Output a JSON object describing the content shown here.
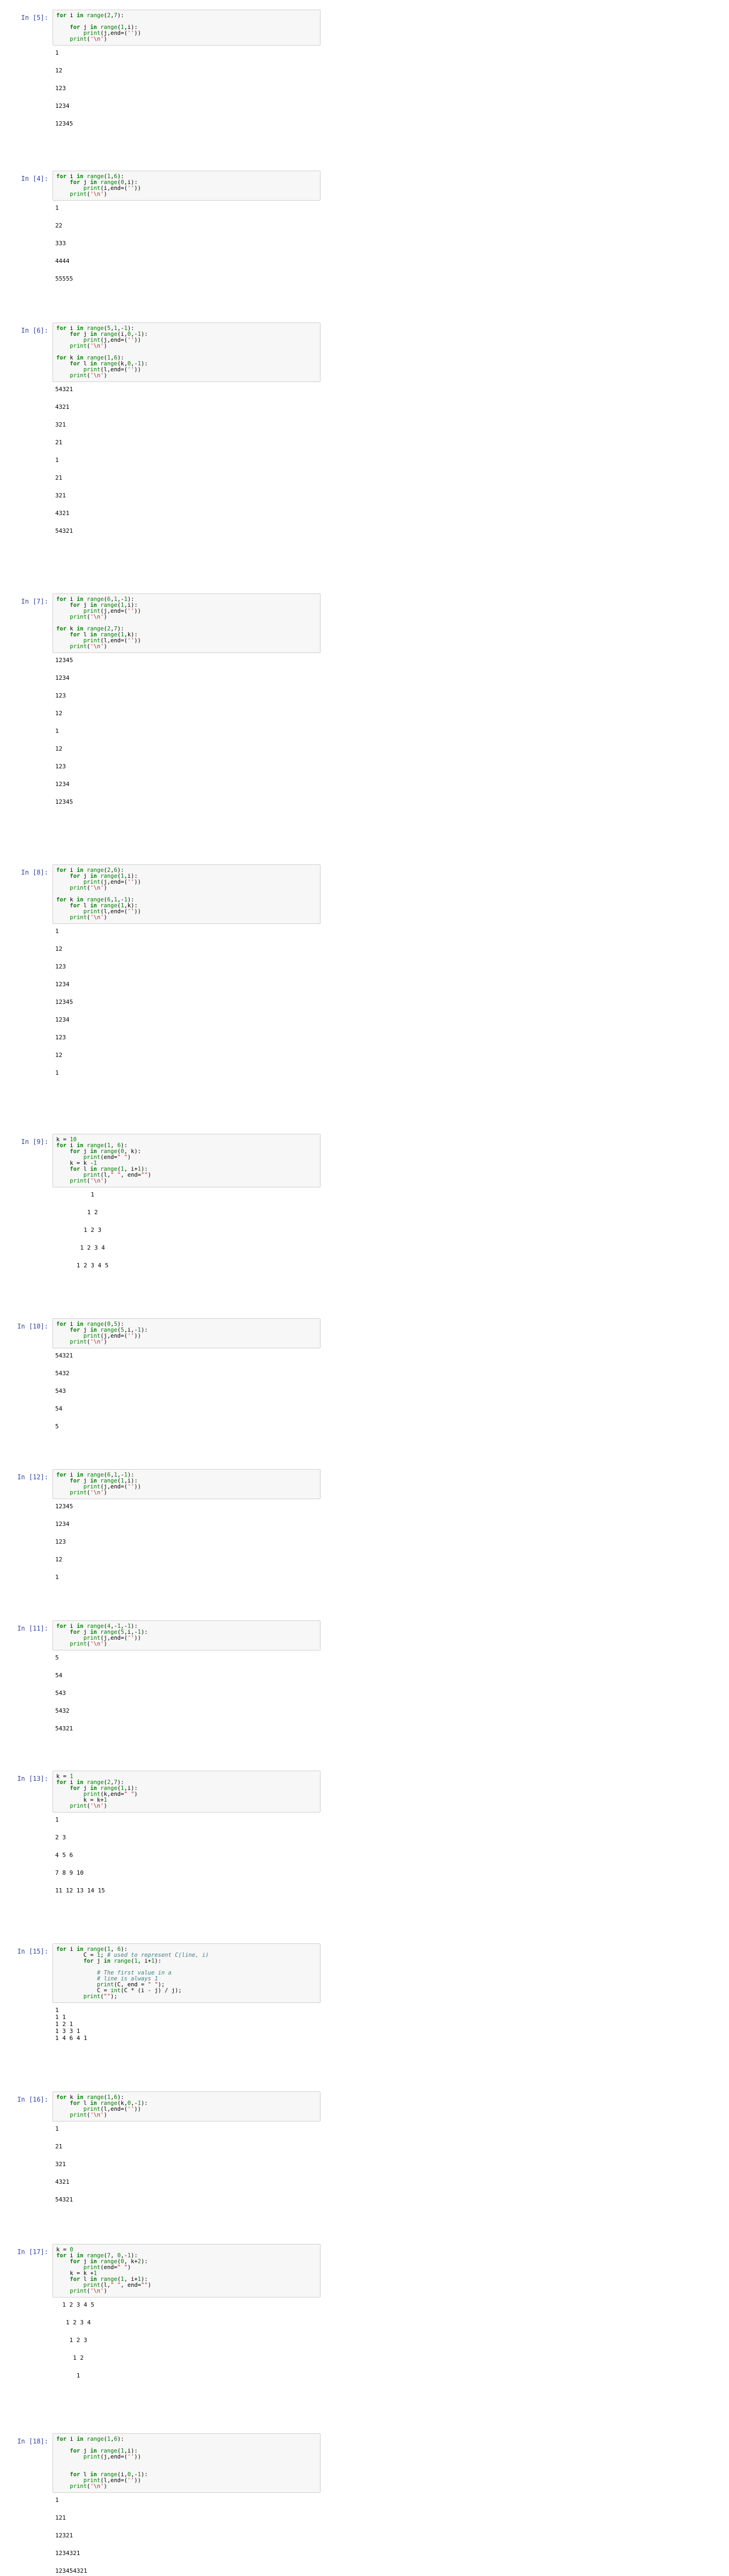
{
  "notebook": {
    "cells": [
      {
        "prompt": "In [5]:",
        "code": [
          "for i in range(2,7):",
          "",
          "    for j in range(1,i):",
          "        print(j,end=(''))",
          "    print('\\n')"
        ],
        "output": [
          "1",
          "",
          "12",
          "",
          "123",
          "",
          "1234",
          "",
          "12345",
          ""
        ]
      },
      {
        "prompt": "In [4]:",
        "code": [
          "for i in range(1,6):",
          "    for j in range(0,i):",
          "        print(i,end=(''))",
          "    print('\\n')"
        ],
        "output": [
          "1",
          "",
          "22",
          "",
          "333",
          "",
          "4444",
          "",
          "55555",
          ""
        ]
      },
      {
        "prompt": "In [6]:",
        "code": [
          "for i in range(5,1,-1):",
          "    for j in range(i,0,-1):",
          "        print(j,end=(''))",
          "    print('\\n')",
          "",
          "for k in range(1,6):",
          "    for l in range(k,0,-1):",
          "        print(l,end=(''))",
          "    print('\\n')"
        ],
        "output": [
          "54321",
          "",
          "4321",
          "",
          "321",
          "",
          "21",
          "",
          "1",
          "",
          "21",
          "",
          "321",
          "",
          "4321",
          "",
          "54321",
          ""
        ]
      },
      {
        "prompt": "In [7]:",
        "code": [
          "for i in range(6,1,-1):",
          "    for j in range(1,i):",
          "        print(j,end=(''))",
          "    print('\\n')",
          "",
          "for k in range(2,7):",
          "    for l in range(1,k):",
          "        print(l,end=(''))",
          "    print('\\n')"
        ],
        "output": [
          "12345",
          "",
          "1234",
          "",
          "123",
          "",
          "12",
          "",
          "1",
          "",
          "12",
          "",
          "123",
          "",
          "1234",
          "",
          "12345",
          ""
        ]
      },
      {
        "prompt": "In [8]:",
        "code": [
          "for i in range(2,6):",
          "    for j in range(1,i):",
          "        print(j,end=(''))",
          "    print('\\n')",
          "",
          "for k in range(6,1,-1):",
          "    for l in range(1,k):",
          "        print(l,end=(''))",
          "    print('\\n')"
        ],
        "output": [
          "1",
          "",
          "12",
          "",
          "123",
          "",
          "1234",
          "",
          "12345",
          "",
          "1234",
          "",
          "123",
          "",
          "12",
          "",
          "1",
          ""
        ]
      },
      {
        "prompt": "In [9]:",
        "code": [
          "k = 10",
          "for i in range(1, 6):",
          "    for j in range(0, k):",
          "        print(end=\" \")",
          "    k = k -1",
          "    for l in range(1, i+1):",
          "        print(l,\" \", end=\"\")",
          "    print('\\n')"
        ],
        "output": [
          "          1",
          "",
          "         1 2",
          "",
          "        1 2 3",
          "",
          "       1 2 3 4",
          "",
          "      1 2 3 4 5",
          ""
        ]
      },
      {
        "prompt": "In [10]:",
        "code": [
          "for i in range(0,5):",
          "    for j in range(5,i,-1):",
          "        print(j,end=(''))",
          "    print('\\n')"
        ],
        "output": [
          "54321",
          "",
          "5432",
          "",
          "543",
          "",
          "54",
          "",
          "5",
          ""
        ]
      },
      {
        "prompt": "In [12]:",
        "code": [
          "for i in range(6,1,-1):",
          "    for j in range(1,i):",
          "        print(j,end=(''))",
          "    print('\\n')"
        ],
        "output": [
          "12345",
          "",
          "1234",
          "",
          "123",
          "",
          "12",
          "",
          "1",
          ""
        ]
      },
      {
        "prompt": "In [11]:",
        "code": [
          "for i in range(4,-1,-1):",
          "    for j in range(5,i,-1):",
          "        print(j,end=(''))",
          "    print('\\n')"
        ],
        "output": [
          "5",
          "",
          "54",
          "",
          "543",
          "",
          "5432",
          "",
          "54321",
          ""
        ]
      },
      {
        "prompt": "In [13]:",
        "code": [
          "k = 1",
          "for i in range(2,7):",
          "    for j in range(1,i):",
          "        print(k,end=\" \")",
          "        k = k+1",
          "    print('\\n')"
        ],
        "output": [
          "1",
          "",
          "2 3",
          "",
          "4 5 6",
          "",
          "7 8 9 10",
          "",
          "11 12 13 14 15",
          ""
        ]
      },
      {
        "prompt": "In [15]:",
        "code": [
          "for i in range(1, 6):",
          "        C = 1; # used to represent C(line, i)",
          "        for j in range(1, i+1):",
          "",
          "            # The first value in a",
          "            # line is always 1",
          "            print(C, end = \" \");",
          "            C = int(C * (i - j) / j);",
          "        print(\"\");"
        ],
        "output_compact": true,
        "output": [
          "1",
          "1 1",
          "1 2 1",
          "1 3 3 1",
          "1 4 6 4 1"
        ]
      },
      {
        "prompt": "In [16]:",
        "code": [
          "for k in range(1,6):",
          "    for l in range(k,0,-1):",
          "        print(l,end=(''))",
          "    print('\\n')"
        ],
        "output": [
          "1",
          "",
          "21",
          "",
          "321",
          "",
          "4321",
          "",
          "54321",
          ""
        ]
      },
      {
        "prompt": "In [17]:",
        "code": [
          "k = 0",
          "for i in range(7, 0,-1):",
          "    for j in range(0, k+2):",
          "        print(end=\" \")",
          "    k = k +1",
          "    for l in range(1, i+1):",
          "        print(l,\" \", end=\"\")",
          "    print('\\n')"
        ],
        "output": [
          "  1 2 3 4 5",
          "",
          "   1 2 3 4",
          "",
          "    1 2 3",
          "",
          "     1 2",
          "",
          "      1",
          ""
        ]
      },
      {
        "prompt": "In [18]:",
        "code": [
          "for i in range(1,6):",
          "",
          "    for j in range(1,i):",
          "        print(j,end=(''))",
          "",
          "",
          "    for l in range(i,0,-1):",
          "        print(l,end=(''))",
          "    print('\\n')"
        ],
        "output": [
          "1",
          "",
          "121",
          "",
          "12321",
          "",
          "1234321",
          "",
          "123454321",
          ""
        ]
      }
    ]
  }
}
